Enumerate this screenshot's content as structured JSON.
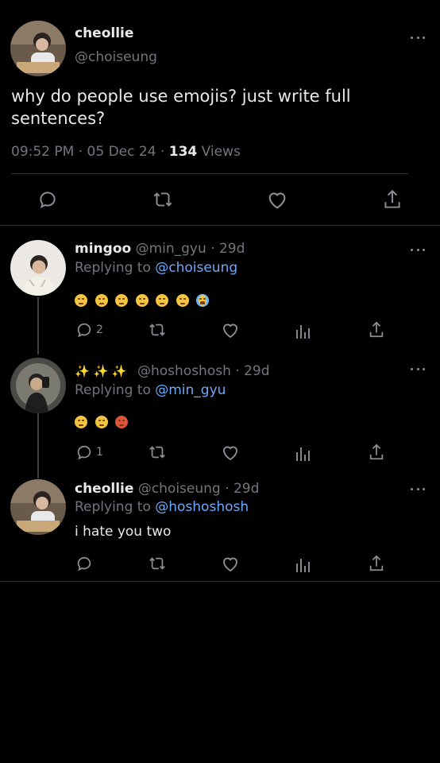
{
  "main_tweet": {
    "display_name": "cheollie",
    "handle": "@choiseung",
    "text": "why do people use emojis? just write full sentences?",
    "time": "09:52 PM",
    "sep1": "·",
    "date": "05 Dec 24",
    "sep2": "·",
    "views_count": "134",
    "views_label": "Views"
  },
  "replies": [
    {
      "display_name": "mingoo",
      "handle": "@min_gyu",
      "sep": "·",
      "age": "29d",
      "replying_prefix": "Replying to",
      "replying_to": "@choiseung",
      "emojis": [
        "confounded-face",
        "slightly-frowning-face",
        "pensive-face",
        "persevering-face",
        "weary-face",
        "tired-face",
        "loudly-crying-face"
      ],
      "reply_count": "2"
    },
    {
      "display_name": "✨ ✨ ✨",
      "handle": "@hoshoshosh",
      "sep": "·",
      "age": "29d",
      "replying_prefix": "Replying to",
      "replying_to": "@min_gyu",
      "emojis": [
        "angry-face",
        "face-with-steam",
        "face-with-symbols-on-mouth"
      ],
      "reply_count": "1"
    },
    {
      "display_name": "cheollie",
      "handle": "@choiseung",
      "sep": "·",
      "age": "29d",
      "replying_prefix": "Replying to",
      "replying_to": "@hoshoshosh",
      "text": "i hate you two",
      "reply_count": ""
    }
  ],
  "colors": {
    "background": "#000000",
    "text": "#e7e9ea",
    "muted": "#71767b",
    "link": "#6ea8f7",
    "divider": "#2f3336"
  }
}
